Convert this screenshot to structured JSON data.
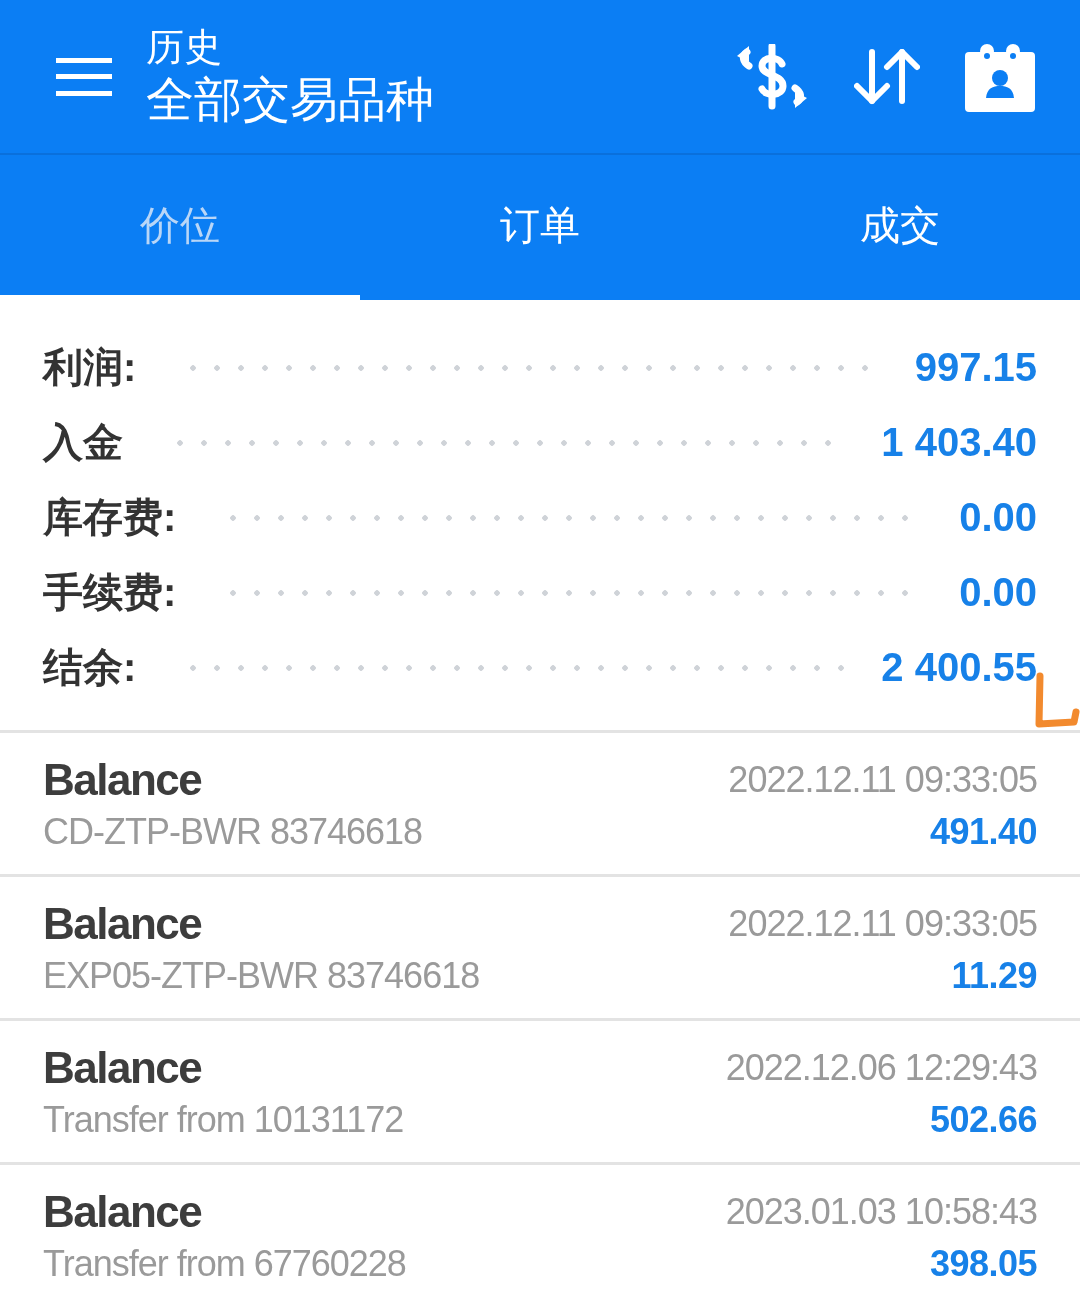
{
  "header": {
    "title": "历史",
    "subtitle": "全部交易品种"
  },
  "tabs": [
    {
      "label": "价位",
      "selected": true
    },
    {
      "label": "订单",
      "selected": false
    },
    {
      "label": "成交",
      "selected": false
    }
  ],
  "summary": [
    {
      "label": "利润:",
      "value": "997.15"
    },
    {
      "label": "入金",
      "value": "1 403.40"
    },
    {
      "label": "库存费:",
      "value": "0.00"
    },
    {
      "label": "手续费:",
      "value": "0.00"
    },
    {
      "label": "结余:",
      "value": "2 400.55"
    }
  ],
  "deals": [
    {
      "type": "Balance",
      "comment": "CD-ZTP-BWR 83746618",
      "time": "2022.12.11 09:33:05",
      "amount": "491.40"
    },
    {
      "type": "Balance",
      "comment": "EXP05-ZTP-BWR 83746618",
      "time": "2022.12.11 09:33:05",
      "amount": "11.29"
    },
    {
      "type": "Balance",
      "comment": "Transfer from 10131172",
      "time": "2022.12.06 12:29:43",
      "amount": "502.66"
    },
    {
      "type": "Balance",
      "comment": "Transfer from 67760228",
      "time": "2023.01.03 10:58:43",
      "amount": "398.05"
    }
  ]
}
